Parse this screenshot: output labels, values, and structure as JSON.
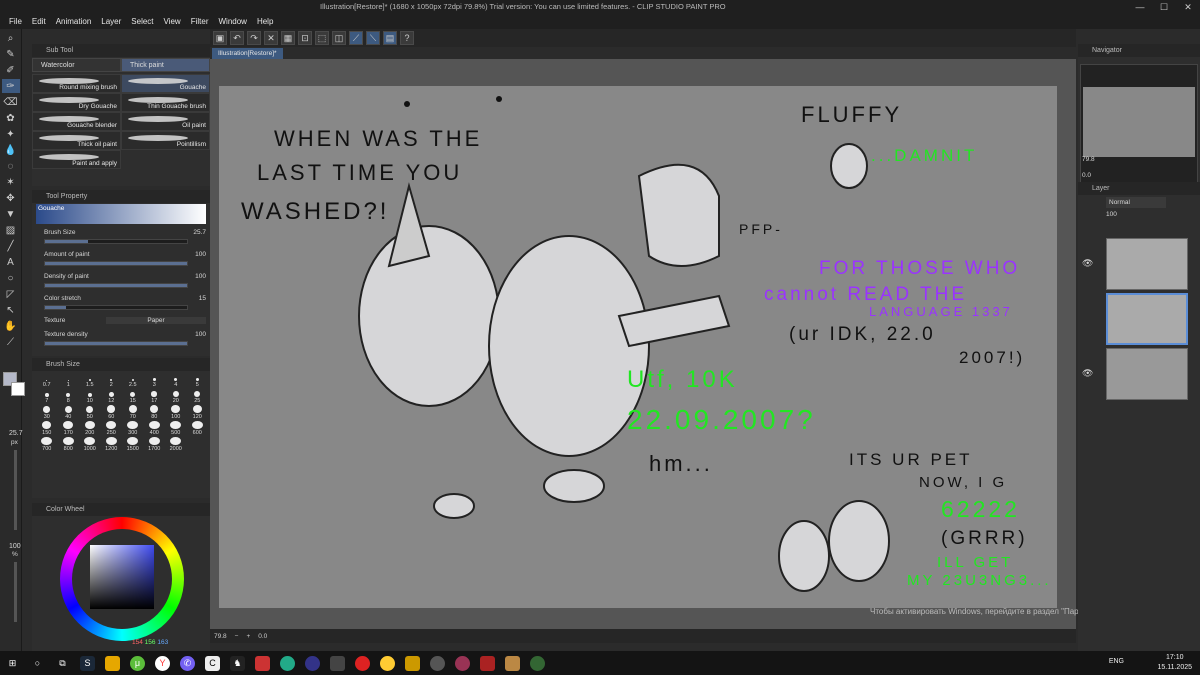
{
  "window": {
    "title": "Illustration[Restore]* (1680 x 1050px 72dpi 79.8%)  Trial version: You can use limited features. - CLIP STUDIO PAINT PRO",
    "minimize": "—",
    "maximize": "☐",
    "close": "✕"
  },
  "menu": [
    "File",
    "Edit",
    "Animation",
    "Layer",
    "Select",
    "View",
    "Filter",
    "Window",
    "Help"
  ],
  "subtool": {
    "header": "Sub Tool",
    "tabs": [
      "Watercolor",
      "Thick paint"
    ],
    "brushes": [
      "Round mixing brush",
      "Gouache",
      "Dry Gouache",
      "Thin Gouache brush",
      "Gouache blender",
      "Oil paint",
      "Thick oil paint",
      "Pointillism",
      "Paint and apply"
    ]
  },
  "toolprop": {
    "header": "Tool Property",
    "preset": "Gouache",
    "rows": [
      {
        "label": "Brush Size",
        "value": "25.7"
      },
      {
        "label": "Amount of paint",
        "value": "100"
      },
      {
        "label": "Density of paint",
        "value": "100"
      },
      {
        "label": "Color stretch",
        "value": "15"
      }
    ],
    "texture_label": "Texture",
    "texture_value": "Paper",
    "texture_density_label": "Texture density",
    "texture_density_value": "100"
  },
  "brushsize": {
    "header": "Brush Size",
    "sizes": [
      "0.7",
      "1",
      "1.5",
      "2",
      "2.5",
      "3",
      "4",
      "5",
      "7",
      "8",
      "10",
      "12",
      "15",
      "17",
      "20",
      "25",
      "30",
      "40",
      "50",
      "60",
      "70",
      "80",
      "100",
      "120",
      "150",
      "170",
      "200",
      "250",
      "300",
      "400",
      "500",
      "600",
      "700",
      "800",
      "1000",
      "1200",
      "1500",
      "1700",
      "2000"
    ]
  },
  "leftside": {
    "brush_size_readout": "25.7",
    "brush_size_unit": "px",
    "opacity_readout": "100",
    "opacity_unit": "%"
  },
  "colorwheel": {
    "header": "Color Wheel",
    "r": "154",
    "g": "156",
    "b": "163"
  },
  "doctab": "Illustration[Restore]*",
  "canvas_text": {
    "q1": "WHEN WAS THE",
    "q2": "LAST TIME YOU",
    "q3": "WASHED?!",
    "fluffy": "FLUFFY",
    "damnit": "...DAMNIT",
    "pfp": "PFP-",
    "for_those": "FOR THOSE WHO",
    "cannot": "cannot READ THE",
    "language": "LANGUAGE 1337",
    "idk1": "(ur IDK, 22.0",
    "idk2": "2007!)",
    "utf": "Utf, 10K",
    "date": "22.09.2007?",
    "hm": "hm...",
    "its": "ITS UR PET",
    "now": "NOW, I G",
    "n62222": "62222",
    "grrr": "(GRRR)",
    "ill": "ILL GET",
    "my": "MY 23U3NG3..."
  },
  "status": {
    "zoom": "79.8",
    "angle": "0.0"
  },
  "watermark": "Чтобы активировать Windows, перейдите в раздел \"Параметры\".",
  "rightpanel": {
    "navigator": "Navigator",
    "zoom": "79.8",
    "angle": "0.0",
    "layer_header": "Layer",
    "blend": "Normal",
    "opacity": "100"
  },
  "taskbar": {
    "lang": "ENG",
    "time": "17:10",
    "date": "15.11.2025"
  },
  "colors": {
    "accent": "#3d5a80",
    "canvas": "#888888",
    "green_text": "#22e622",
    "purple_text": "#9a33ff"
  }
}
